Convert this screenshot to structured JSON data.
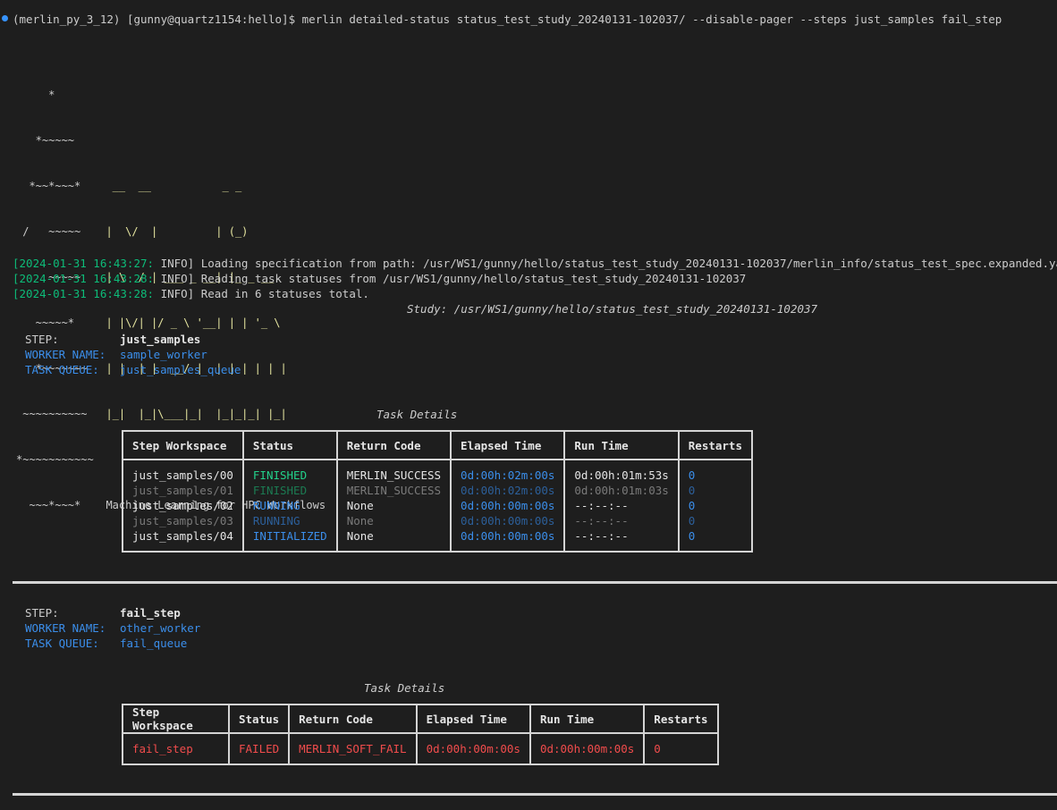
{
  "prompt": {
    "env": "(merlin_py_3_12)",
    "userhost": "[gunny@quartz1154:hello]$",
    "command": "merlin detailed-status status_test_study_20240131-102037/ --disable-pager --steps just_samples fail_step"
  },
  "banner": {
    "tree": [
      "     *",
      "   *~~~~~",
      "  *~~*~~~*",
      " /   ~~~~~",
      "     ~~~~~",
      "   ~~~~~*",
      "   *~~~~~~~",
      " ~~~~~~~~~~",
      "*~~~~~~~~~~~",
      "  ~~~*~~~*"
    ],
    "logo": [
      "",
      "",
      "   __  __           _ _",
      "  |  \\/  |         | (_)",
      "  | \\  / | ___ _ __| |_ _ __",
      "  | |\\/| |/ _ \\ '__| | | '_ \\",
      "  | |  | |  __/ |  | | | | | |",
      "  |_|  |_|\\___|_|  |_|_|_| |_|",
      "",
      "  Machine Learning for HPC Workflows"
    ]
  },
  "logs": [
    {
      "ts": "[2024-01-31 16:43:27:",
      "level": "INFO]",
      "msg": "Loading specification from path: /usr/WS1/gunny/hello/status_test_study_20240131-102037/merlin_info/status_test_spec.expanded.yaml"
    },
    {
      "ts": "[2024-01-31 16:43:28:",
      "level": "INFO]",
      "msg": "Reading task statuses from /usr/WS1/gunny/hello/status_test_study_20240131-102037"
    },
    {
      "ts": "[2024-01-31 16:43:28:",
      "level": "INFO]",
      "msg": "Read in 6 statuses total."
    }
  ],
  "study_line": "Study: /usr/WS1/gunny/hello/status_test_study_20240131-102037",
  "steps": [
    {
      "step_label": "STEP:",
      "step_value": "just_samples",
      "worker_label": "WORKER NAME:",
      "worker_value": "sample_worker",
      "queue_label": "TASK QUEUE:",
      "queue_value": "just_samples_queue",
      "caption": "Task Details",
      "headers": [
        "Step Workspace",
        "Status",
        "Return Code",
        "Elapsed Time",
        "Run Time",
        "Restarts"
      ],
      "rows": [
        {
          "workspace": "just_samples/00",
          "status": "FINISHED",
          "return_code": "MERLIN_SUCCESS",
          "elapsed": "0d:00h:02m:00s",
          "run": "0d:00h:01m:53s",
          "restarts": "0"
        },
        {
          "workspace": "just_samples/01",
          "status": "FINISHED",
          "return_code": "MERLIN_SUCCESS",
          "elapsed": "0d:00h:02m:00s",
          "run": "0d:00h:01m:03s",
          "restarts": "0"
        },
        {
          "workspace": "just_samples/02",
          "status": "RUNNING",
          "return_code": "None",
          "elapsed": "0d:00h:00m:00s",
          "run": "--:--:--",
          "restarts": "0"
        },
        {
          "workspace": "just_samples/03",
          "status": "RUNNING",
          "return_code": "None",
          "elapsed": "0d:00h:00m:00s",
          "run": "--:--:--",
          "restarts": "0"
        },
        {
          "workspace": "just_samples/04",
          "status": "INITIALIZED",
          "return_code": "None",
          "elapsed": "0d:00h:00m:00s",
          "run": "--:--:--",
          "restarts": "0"
        }
      ]
    },
    {
      "step_label": "STEP:",
      "step_value": "fail_step",
      "worker_label": "WORKER NAME:",
      "worker_value": "other_worker",
      "queue_label": "TASK QUEUE:",
      "queue_value": "fail_queue",
      "caption": "Task Details",
      "headers": [
        "Step Workspace",
        "Status",
        "Return Code",
        "Elapsed Time",
        "Run Time",
        "Restarts"
      ],
      "rows": [
        {
          "workspace": "fail_step",
          "status": "FAILED",
          "return_code": "MERLIN_SOFT_FAIL",
          "elapsed": "0d:00h:00m:00s",
          "run": "0d:00h:00m:00s",
          "restarts": "0"
        }
      ]
    }
  ],
  "colors": {
    "background": "#1e1e1e",
    "timestamp_green": "#0dbc79",
    "status_green": "#23d18b",
    "accent_blue": "#3b8eea",
    "fail_red": "#f14c4c",
    "logo_yellow": "#e5e5a0"
  }
}
